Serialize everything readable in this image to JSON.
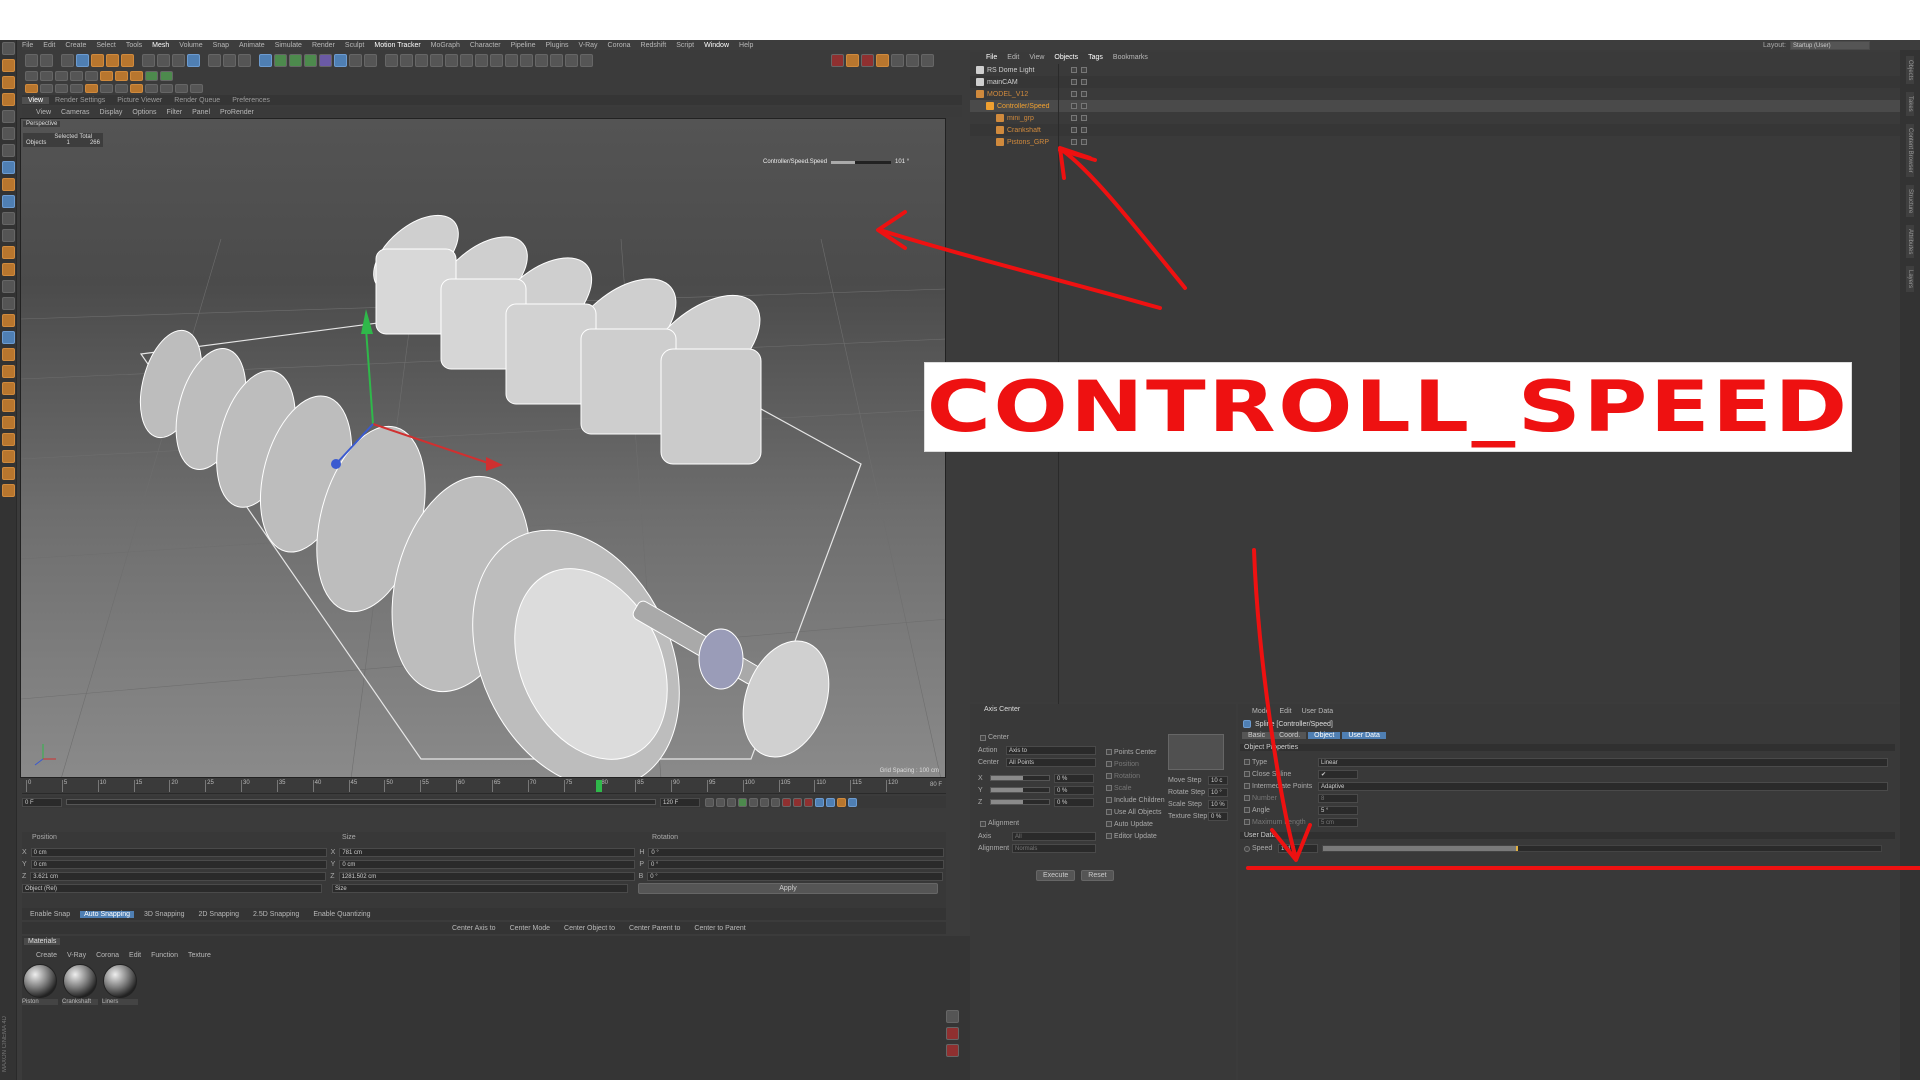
{
  "menu_bar": {
    "items": [
      "File",
      "Edit",
      "Create",
      "Select",
      "Tools",
      "Mesh",
      "Volume",
      "Snap",
      "Animate",
      "Simulate",
      "Render",
      "Sculpt",
      "Motion Tracker",
      "MoGraph",
      "Character",
      "Pipeline",
      "Plugins",
      "V-Ray",
      "Corona",
      "Redshift",
      "Script",
      "Window",
      "Help"
    ],
    "layout_label": "Layout:",
    "layout_value": "Startup (User)"
  },
  "viewport": {
    "tabs": [
      "View",
      "Render Settings",
      "Picture Viewer",
      "Render Queue",
      "Preferences"
    ],
    "menu": [
      "View",
      "Cameras",
      "Display",
      "Options",
      "Filter",
      "Panel",
      "ProRender"
    ],
    "camera_label": "Perspective",
    "stats_header": "Selected Total",
    "stats_label": "Objects",
    "stats_selected": "1",
    "stats_total": "266",
    "hud_label": "Controller/Speed.Speed",
    "hud_value": "101 °",
    "hud_fraction": 0.4,
    "grid_spacing": "Grid Spacing : 100 cm"
  },
  "timeline": {
    "ticks": [
      "0",
      "5",
      "10",
      "15",
      "20",
      "25",
      "30",
      "35",
      "40",
      "45",
      "50",
      "55",
      "60",
      "65",
      "70",
      "75",
      "80",
      "85",
      "90",
      "95",
      "100",
      "105",
      "110",
      "115",
      "120"
    ],
    "current_frame": "80",
    "end_frame_field": "80 F",
    "start_field": "0 F",
    "min_field": "0 F",
    "max_field": "120 F",
    "max_field2": "120 F"
  },
  "coordinates": {
    "headers": [
      "Position",
      "Size",
      "Rotation"
    ],
    "rows": [
      {
        "axis": "X",
        "pos": "0 cm",
        "size_axis": "X",
        "size": "781 cm",
        "rot_axis": "H",
        "rot": "0 °"
      },
      {
        "axis": "Y",
        "pos": "0 cm",
        "size_axis": "Y",
        "size": "0 cm",
        "rot_axis": "P",
        "rot": "0 °"
      },
      {
        "axis": "Z",
        "pos": "3.621 cm",
        "size_axis": "Z",
        "size": "1281.502 cm",
        "rot_axis": "B",
        "rot": "0 °"
      }
    ],
    "mode_select": "Object (Rel)",
    "size_select": "Size",
    "apply_label": "Apply"
  },
  "snap_bar": {
    "items": [
      "Enable Snap",
      "Auto Snapping",
      "3D Snapping",
      "2D Snapping",
      "2.5D Snapping",
      "Enable Quantizing"
    ],
    "active_index": 1,
    "row2": [
      "Center Axis to",
      "Center Mode",
      "Center Object to",
      "Center Parent to",
      "Center to Parent"
    ]
  },
  "materials": {
    "tab": "Materials",
    "menu": [
      "Create",
      "V-Ray",
      "Corona",
      "Edit",
      "Function",
      "Texture"
    ],
    "items": [
      "Piston",
      "Crankshaft",
      "Liners"
    ]
  },
  "object_manager": {
    "menu": [
      "File",
      "Edit",
      "View",
      "Objects",
      "Tags",
      "Bookmarks"
    ],
    "rows": [
      {
        "name": "RS Dome Light",
        "color": "#cfcfcf",
        "indent": 0,
        "selected": false
      },
      {
        "name": "mainCAM",
        "color": "#cfcfcf",
        "indent": 0,
        "selected": false
      },
      {
        "name": "MODEL_V12",
        "color": "#d08a3d",
        "indent": 0,
        "selected": false
      },
      {
        "name": "Controller/Speed",
        "color": "#f0a030",
        "indent": 1,
        "selected": true
      },
      {
        "name": "mini_grp",
        "color": "#d08a3d",
        "indent": 2,
        "selected": false
      },
      {
        "name": "Crankshaft",
        "color": "#d08a3d",
        "indent": 2,
        "selected": false
      },
      {
        "name": "Pistons_GRP",
        "color": "#d08a3d",
        "indent": 2,
        "selected": false
      }
    ]
  },
  "axis_center": {
    "title": "Axis Center",
    "center_label": "Center",
    "action_label": "Action",
    "action_value": "Axis to",
    "center2_label": "Center",
    "center2_value": "All Points",
    "sliders": [
      {
        "axis": "X",
        "value": "0 %"
      },
      {
        "axis": "Y",
        "value": "0 %"
      },
      {
        "axis": "Z",
        "value": "0 %"
      }
    ],
    "alignment": "Alignment",
    "axis_label": "Axis",
    "axis_value": "All",
    "alignment_label": "Alignment",
    "alignment_value": "Normals",
    "checks": [
      "Points Center",
      "Position",
      "Rotation",
      "Scale",
      "Include Children",
      "Use All Objects",
      "Auto Update",
      "Editor Update"
    ],
    "execute": "Execute",
    "reset": "Reset",
    "steps": [
      {
        "label": "Move Step",
        "value": "10 c"
      },
      {
        "label": "Rotate Step",
        "value": "10 °"
      },
      {
        "label": "Scale Step",
        "value": "10 %"
      },
      {
        "label": "Texture Step",
        "value": "0 %"
      }
    ]
  },
  "attributes": {
    "menu": [
      "Mode",
      "Edit",
      "User Data"
    ],
    "object_title": "Spline [Controller/Speed]",
    "tabs": [
      "Basic",
      "Coord.",
      "Object",
      "User Data"
    ],
    "active_tabs": [
      2,
      3
    ],
    "section": "Object Properties",
    "props": [
      {
        "label": "Type",
        "value": "Linear"
      },
      {
        "label": "Close Spline",
        "value": "✔"
      },
      {
        "label": "Intermediate Points",
        "value": "Adaptive"
      },
      {
        "label": "Number",
        "value": "8"
      },
      {
        "label": "Angle",
        "value": "5 °"
      },
      {
        "label": "Maximum Length",
        "value": "5 cm"
      }
    ],
    "user_data_section": "User Data",
    "speed_label": "Speed",
    "speed_value": "101 °",
    "speed_fraction": 0.35
  },
  "annotation": {
    "banner_text": "CONTROLL_SPEED",
    "color": "#ee1111"
  },
  "side_labels": [
    "Objects",
    "Takes",
    "Content Browser",
    "Structure",
    "Attributes",
    "Layers"
  ],
  "watermark": "MAXON CINEMA 4D"
}
